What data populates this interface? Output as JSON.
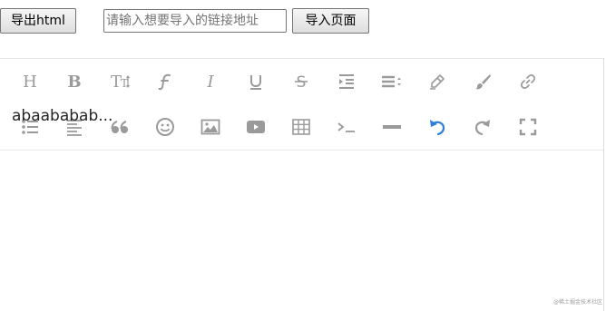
{
  "top_bar": {
    "export_label": "导出html",
    "url_placeholder": "请输入想要导入的链接地址",
    "url_value": "",
    "import_label": "导入页面"
  },
  "toolbar": {
    "row1": [
      "heading-icon",
      "bold-icon",
      "text-size-icon",
      "font-family-icon",
      "italic-icon",
      "underline-icon",
      "strikethrough-icon",
      "indent-icon",
      "align-icon",
      "highlighter-icon",
      "brush-icon",
      "link-icon"
    ],
    "row2": [
      "bullet-list-icon",
      "align-left-icon",
      "quote-icon",
      "emoji-icon",
      "image-icon",
      "video-icon",
      "table-icon",
      "code-icon",
      "horizontal-rule-icon",
      "undo-icon",
      "redo-icon",
      "fullscreen-icon"
    ],
    "active_color": "#2d7fd6",
    "icon_color": "#9a9a9a"
  },
  "content": {
    "text": "abaababab..."
  },
  "watermark": "@稀土掘金技术社区"
}
